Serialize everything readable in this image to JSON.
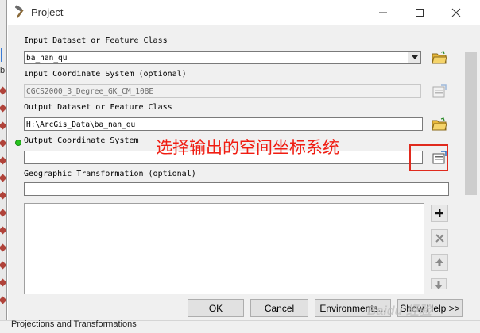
{
  "window": {
    "title": "Project"
  },
  "form": {
    "input_dataset": {
      "label": "Input Dataset or Feature Class",
      "value": "ba_nan_qu"
    },
    "input_coord": {
      "label": "Input Coordinate System (optional)",
      "value": "CGCS2000_3_Degree_GK_CM_108E"
    },
    "output_dataset": {
      "label": "Output Dataset or Feature Class",
      "value": "H:\\ArcGis_Data\\ba_nan_qu"
    },
    "output_coord": {
      "label": "Output Coordinate System",
      "value": ""
    },
    "geo_transform": {
      "label": "Geographic Transformation (optional)",
      "value": ""
    }
  },
  "annotation": {
    "text": "选择输出的空间坐标系统",
    "color": "#f01d12"
  },
  "footer": {
    "ok": "OK",
    "cancel": "Cancel",
    "environments": "Environments...",
    "show_help": "Show Help >>"
  },
  "background": {
    "left_letter": "b",
    "bottom_text": "Projections and Transformations"
  },
  "watermark": "Baidu 经验",
  "icons": {
    "title": "hammer-icon",
    "browse": "open-folder-icon",
    "properties": "spatial-reference-properties-icon",
    "add": "plus-icon",
    "remove": "x-icon",
    "up": "up-arrow-icon",
    "down": "down-arrow-icon"
  }
}
